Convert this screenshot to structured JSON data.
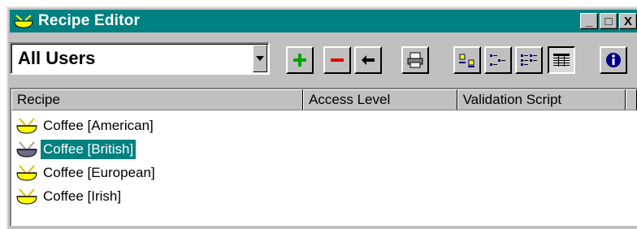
{
  "window": {
    "title": "Recipe Editor",
    "minimize_glyph": "_",
    "maximize_glyph": "□",
    "close_glyph": "X"
  },
  "toolbar": {
    "user_filter": "All Users",
    "buttons": [
      {
        "name": "add-recipe-button",
        "icon": "plus-icon"
      },
      {
        "name": "delete-recipe-button",
        "icon": "minus-icon"
      },
      {
        "name": "back-button",
        "icon": "arrow-left-icon"
      },
      {
        "name": "print-button",
        "icon": "printer-icon"
      },
      {
        "name": "large-icons-view-button",
        "icon": "large-icons-icon"
      },
      {
        "name": "small-icons-view-button",
        "icon": "small-icons-icon"
      },
      {
        "name": "list-view-button",
        "icon": "list-icon"
      },
      {
        "name": "details-view-button",
        "icon": "details-icon"
      },
      {
        "name": "info-button",
        "icon": "info-icon"
      }
    ],
    "colors": {
      "plus": "#00a000",
      "minus": "#e00000",
      "info_bg": "#000080"
    }
  },
  "list": {
    "columns": [
      "Recipe",
      "Access Level",
      "Validation Script"
    ],
    "rows": [
      {
        "label": "Coffee [American]",
        "selected": false
      },
      {
        "label": "Coffee [British]",
        "selected": true
      },
      {
        "label": "Coffee [European]",
        "selected": false
      },
      {
        "label": "Coffee [Irish]",
        "selected": false
      }
    ],
    "selection_color": "#008080"
  }
}
